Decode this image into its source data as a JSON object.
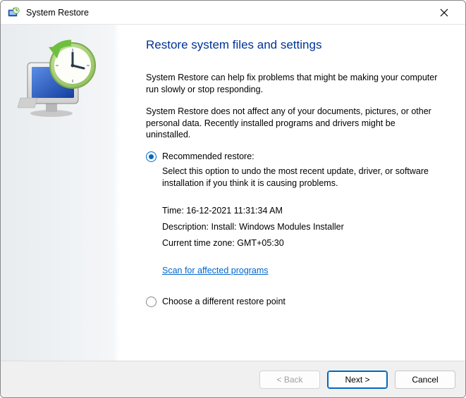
{
  "titlebar": {
    "title": "System Restore"
  },
  "content": {
    "heading": "Restore system files and settings",
    "para1": "System Restore can help fix problems that might be making your computer run slowly or stop responding.",
    "para2": "System Restore does not affect any of your documents, pictures, or other personal data. Recently installed programs and drivers might be uninstalled.",
    "options": {
      "recommended": {
        "label": "Recommended restore:",
        "description": "Select this option to undo the most recent update, driver, or software installation if you think it is causing problems.",
        "time_line": "Time: 16-12-2021 11:31:34 AM",
        "desc_line": "Description: Install: Windows Modules Installer",
        "tz_line": "Current time zone: GMT+05:30",
        "scan_link": "Scan for affected programs"
      },
      "different": {
        "label": "Choose a different restore point"
      }
    }
  },
  "footer": {
    "back": "< Back",
    "next": "Next >",
    "cancel": "Cancel"
  }
}
